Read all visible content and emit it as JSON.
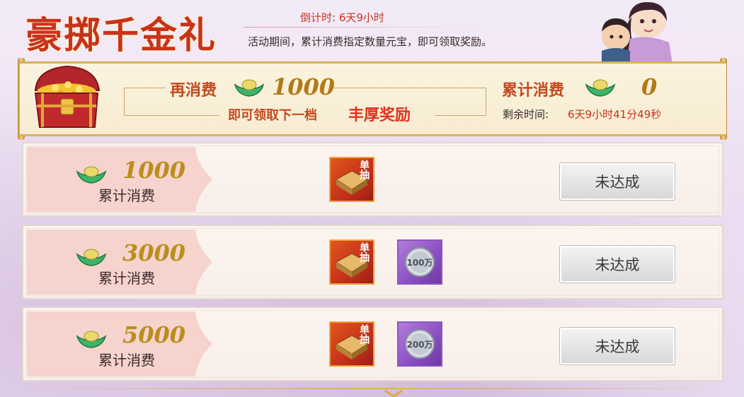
{
  "header": {
    "title": "豪掷千金礼",
    "countdown": "倒计时: 6天9小时",
    "description": "活动期间，累计消费指定数量元宝，即可领取奖励。"
  },
  "banner": {
    "again_label": "再消费",
    "again_value": "1000",
    "next_text": "即可领取下一档",
    "next_emphasis": "丰厚奖励",
    "total_label": "累计消费",
    "total_value": "0",
    "remain_label": "剩余时间:",
    "remain_value": "6天9小时41分49秒"
  },
  "tiers": [
    {
      "value": "1000",
      "label": "累计消费",
      "rewards": [
        {
          "type": "draw",
          "icon": "single-draw-icon",
          "text": "单抽"
        }
      ],
      "status": "未达成"
    },
    {
      "value": "3000",
      "label": "累计消费",
      "rewards": [
        {
          "type": "draw",
          "icon": "single-draw-icon",
          "text": "单抽"
        },
        {
          "type": "coin",
          "icon": "silver-coin-icon",
          "text": "100万"
        }
      ],
      "status": "未达成"
    },
    {
      "value": "5000",
      "label": "累计消费",
      "rewards": [
        {
          "type": "draw",
          "icon": "single-draw-icon",
          "text": "单抽"
        },
        {
          "type": "coin",
          "icon": "silver-coin-icon",
          "text": "200万"
        }
      ],
      "status": "未达成"
    }
  ],
  "colors": {
    "title_red": "#c8331c",
    "gold": "#b07a16",
    "draw_reward_bg": "#d1411c",
    "coin_reward_bg": "#8a4fc0"
  }
}
